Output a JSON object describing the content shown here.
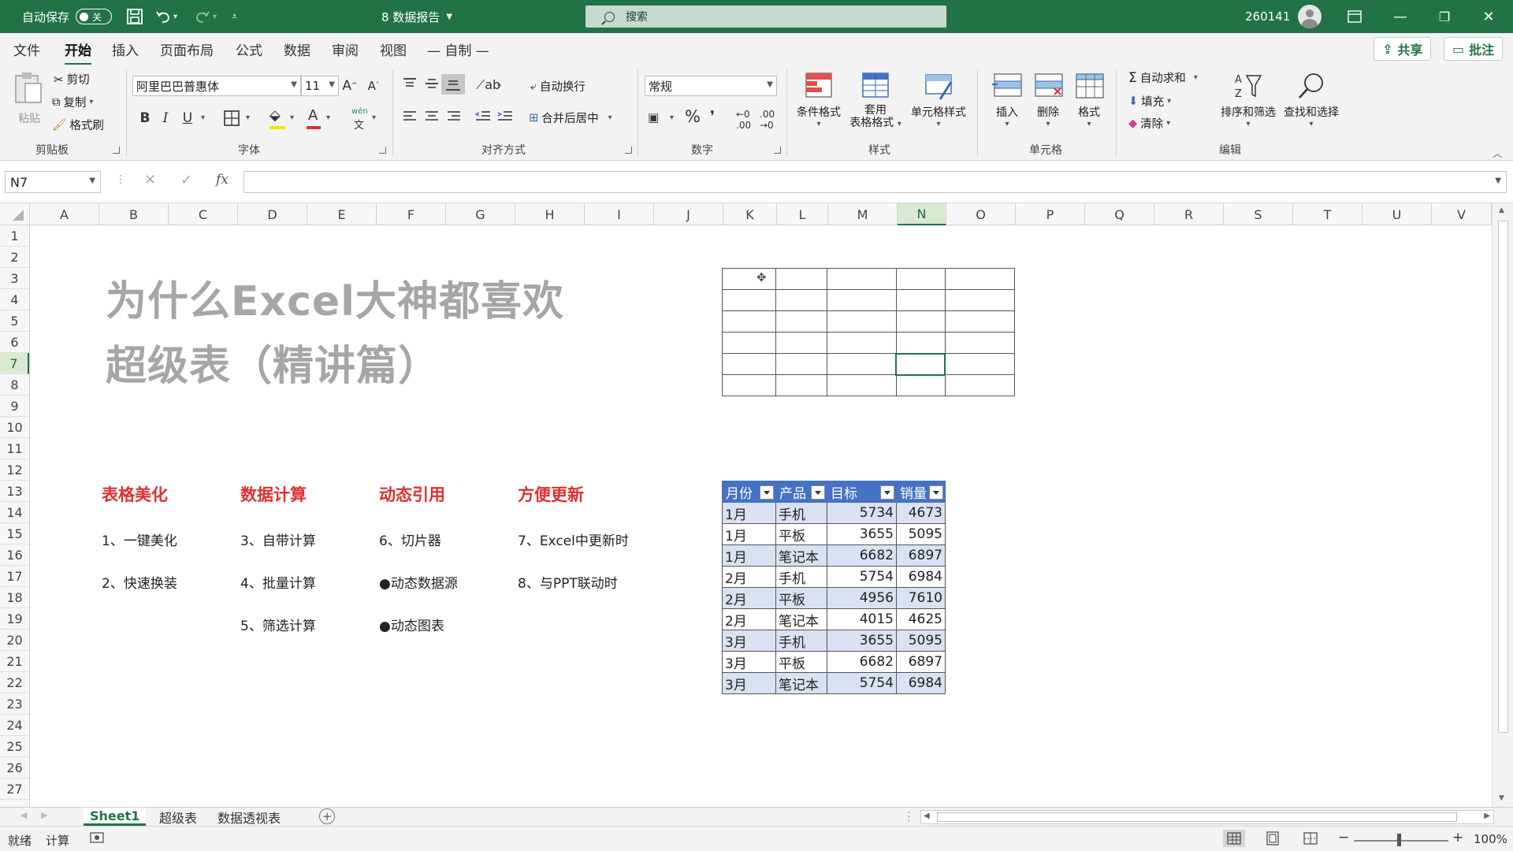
{
  "titlebar": {
    "autosave_label": "自动保存",
    "autosave_state": "关",
    "doc_title": "8 数据报告",
    "search_placeholder": "搜索",
    "user": "260141"
  },
  "menu": {
    "tabs": [
      "文件",
      "开始",
      "插入",
      "页面布局",
      "公式",
      "数据",
      "审阅",
      "视图",
      "— 自制 —"
    ],
    "active": "开始",
    "share_label": "共享",
    "comment_label": "批注"
  },
  "ribbon": {
    "clipboard": {
      "label": "剪贴板",
      "paste": "粘贴",
      "cut": "剪切",
      "copy": "复制",
      "format_painter": "格式刷"
    },
    "font": {
      "label": "字体",
      "name": "阿里巴巴普惠体",
      "size": "11",
      "bold": "B",
      "italic": "I",
      "underline": "U",
      "wen": "wén"
    },
    "alignment": {
      "label": "对齐方式",
      "wrap": "自动换行",
      "merge": "合并后居中"
    },
    "number": {
      "label": "数字",
      "format": "常规",
      "percent": "%"
    },
    "styles": {
      "label": "样式",
      "conditional": "条件格式",
      "table_line1": "套用",
      "table_line2": "表格格式",
      "cell_styles": "单元格样式"
    },
    "cells": {
      "label": "单元格",
      "insert": "插入",
      "delete": "删除",
      "format": "格式"
    },
    "editing": {
      "label": "编辑",
      "autosum": "自动求和",
      "fill": "填充",
      "clear": "清除",
      "sort": "排序和筛选",
      "find": "查找和选择"
    }
  },
  "formula_bar": {
    "name_box": "N7",
    "fx": "fx",
    "value": ""
  },
  "columns": [
    "A",
    "B",
    "C",
    "D",
    "E",
    "F",
    "G",
    "H",
    "I",
    "J",
    "K",
    "L",
    "M",
    "N",
    "O",
    "P",
    "Q",
    "R",
    "S",
    "T",
    "U",
    "V"
  ],
  "selected_column": "N",
  "rows": [
    "1",
    "2",
    "3",
    "4",
    "5",
    "6",
    "7",
    "8",
    "9",
    "10",
    "11",
    "12",
    "13",
    "14",
    "15",
    "16",
    "17",
    "18",
    "19",
    "20",
    "21",
    "22",
    "23",
    "24",
    "25",
    "26",
    "27"
  ],
  "selected_row": "7",
  "content": {
    "title_line1": "为什么Excel大神都喜欢",
    "title_line2": "超级表（精讲篇）",
    "sections": [
      {
        "heading": "表格美化",
        "items": [
          "1、一键美化",
          "2、快速换装"
        ]
      },
      {
        "heading": "数据计算",
        "items": [
          "3、自带计算",
          "4、批量计算",
          "5、筛选计算"
        ]
      },
      {
        "heading": "动态引用",
        "items": [
          "6、切片器",
          "●动态数据源",
          "●动态图表"
        ]
      },
      {
        "heading": "方便更新",
        "items": [
          "7、Excel中更新时",
          "8、与PPT联动时"
        ]
      }
    ]
  },
  "sales_table": {
    "headers": [
      "月份",
      "产品",
      "目标",
      "销量"
    ],
    "rows": [
      [
        "1月",
        "手机",
        "5734",
        "4673"
      ],
      [
        "1月",
        "平板",
        "3655",
        "5095"
      ],
      [
        "1月",
        "笔记本",
        "6682",
        "6897"
      ],
      [
        "2月",
        "手机",
        "5754",
        "6984"
      ],
      [
        "2月",
        "平板",
        "4956",
        "7610"
      ],
      [
        "2月",
        "笔记本",
        "4015",
        "4625"
      ],
      [
        "3月",
        "手机",
        "3655",
        "5095"
      ],
      [
        "3月",
        "平板",
        "6682",
        "6897"
      ],
      [
        "3月",
        "笔记本",
        "5754",
        "6984"
      ]
    ]
  },
  "sheet_tabs": [
    "Sheet1",
    "超级表",
    "数据透视表"
  ],
  "active_sheet": "Sheet1",
  "status": {
    "ready": "就绪",
    "calc": "计算",
    "zoom": "100%"
  },
  "colors": {
    "accent": "#217346",
    "table_header": "#4472c4",
    "table_band": "#d9e1f2",
    "section_red": "#e03030",
    "title_gray": "#a6a6a6"
  }
}
